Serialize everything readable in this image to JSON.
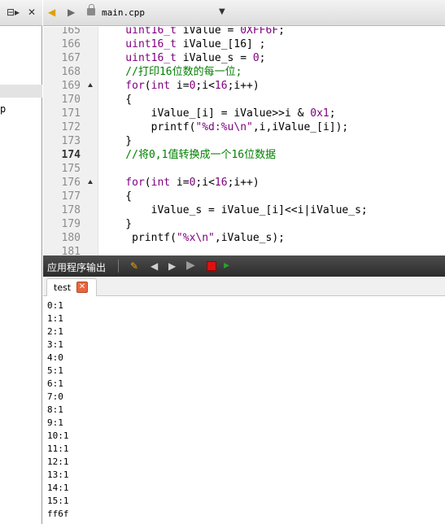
{
  "left_pane": {
    "toolbar_icon": "⊟▸",
    "close_glyph": "✕",
    "fragment": "p"
  },
  "editor_tab": {
    "back_icon": "◆",
    "forward_icon": "◆",
    "filename": "main.cpp",
    "dropdown_glyph": "▼"
  },
  "code": {
    "current_line": "174",
    "lines": [
      {
        "no": "165",
        "fold": false,
        "tokens": [
          [
            "type",
            "    uint16_t"
          ],
          [
            "plain",
            " iValue = "
          ],
          [
            "num",
            "0XFF6F"
          ],
          [
            "plain",
            ";"
          ]
        ]
      },
      {
        "no": "166",
        "fold": false,
        "tokens": [
          [
            "type",
            "    uint16_t"
          ],
          [
            "plain",
            " iValue_[16] ;"
          ]
        ]
      },
      {
        "no": "167",
        "fold": false,
        "tokens": [
          [
            "type",
            "    uint16_t"
          ],
          [
            "plain",
            " iValue_s = "
          ],
          [
            "num",
            "0"
          ],
          [
            "plain",
            ";"
          ]
        ]
      },
      {
        "no": "168",
        "fold": false,
        "tokens": [
          [
            "cmt",
            "    //打印16位数的每一位;"
          ]
        ]
      },
      {
        "no": "169",
        "fold": true,
        "tokens": [
          [
            "kw",
            "    for"
          ],
          [
            "plain",
            "("
          ],
          [
            "kw",
            "int"
          ],
          [
            "plain",
            " i="
          ],
          [
            "num",
            "0"
          ],
          [
            "plain",
            ";i<"
          ],
          [
            "num",
            "16"
          ],
          [
            "plain",
            ";i++)"
          ]
        ]
      },
      {
        "no": "170",
        "fold": false,
        "tokens": [
          [
            "plain",
            "    {"
          ]
        ]
      },
      {
        "no": "171",
        "fold": false,
        "tokens": [
          [
            "plain",
            "        iValue_[i] = iValue>>i & "
          ],
          [
            "num",
            "0x1"
          ],
          [
            "plain",
            ";"
          ]
        ]
      },
      {
        "no": "172",
        "fold": false,
        "tokens": [
          [
            "plain",
            "        printf("
          ],
          [
            "str",
            "\"%d:%u\\n\""
          ],
          [
            "plain",
            ",i,iValue_[i]);"
          ]
        ]
      },
      {
        "no": "173",
        "fold": false,
        "tokens": [
          [
            "plain",
            "    }"
          ]
        ]
      },
      {
        "no": "174",
        "fold": false,
        "tokens": [
          [
            "cmt",
            "    //将0,1值转换成一个16位数据"
          ]
        ]
      },
      {
        "no": "175",
        "fold": false,
        "tokens": [
          [
            "plain",
            ""
          ]
        ]
      },
      {
        "no": "176",
        "fold": true,
        "tokens": [
          [
            "kw",
            "    for"
          ],
          [
            "plain",
            "("
          ],
          [
            "kw",
            "int"
          ],
          [
            "plain",
            " i="
          ],
          [
            "num",
            "0"
          ],
          [
            "plain",
            ";i<"
          ],
          [
            "num",
            "16"
          ],
          [
            "plain",
            ";i++)"
          ]
        ]
      },
      {
        "no": "177",
        "fold": false,
        "tokens": [
          [
            "plain",
            "    {"
          ]
        ]
      },
      {
        "no": "178",
        "fold": false,
        "tokens": [
          [
            "plain",
            "        iValue_s = iValue_[i]<<i|iValue_s;"
          ]
        ]
      },
      {
        "no": "179",
        "fold": false,
        "tokens": [
          [
            "plain",
            "    }"
          ]
        ]
      },
      {
        "no": "180",
        "fold": false,
        "tokens": [
          [
            "plain",
            "     printf("
          ],
          [
            "str",
            "\"%x\\n\""
          ],
          [
            "plain",
            ",iValue_s);"
          ]
        ]
      },
      {
        "no": "181",
        "fold": false,
        "tokens": [
          [
            "plain",
            ""
          ]
        ]
      }
    ]
  },
  "output_panel": {
    "title": "应用程序输出",
    "tab_label": "test",
    "tab_close": "✕",
    "lines": [
      "0:1",
      "1:1",
      "2:1",
      "3:1",
      "4:0",
      "5:1",
      "6:1",
      "7:0",
      "8:1",
      "9:1",
      "10:1",
      "11:1",
      "12:1",
      "13:1",
      "14:1",
      "15:1",
      "ff6f"
    ]
  },
  "colors": {
    "keyword": "#800080",
    "comment": "#008000",
    "header_dark": "#2c2c2c",
    "stop_red": "#e01010",
    "close_orange": "#e8663d"
  }
}
